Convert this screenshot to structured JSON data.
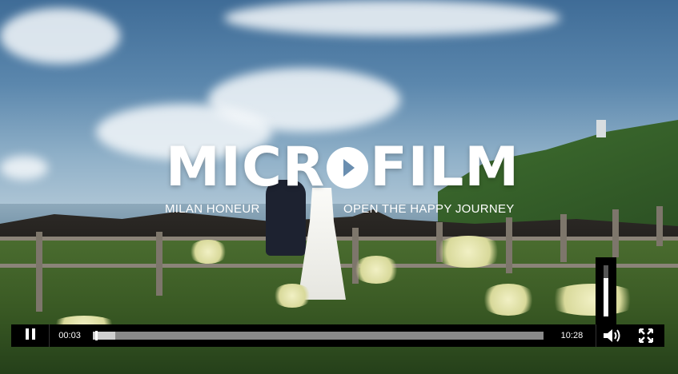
{
  "overlay": {
    "title_left": "MICRO F",
    "title_play": "O",
    "title_pre": "MICR",
    "title_post": " FILM",
    "subtitle_left": "MILAN HONEUR",
    "subtitle_right": "OPEN THE HAPPY JOURNEY"
  },
  "player": {
    "current_time": "00:03",
    "duration": "10:28",
    "progress_fraction": 0.005,
    "buffered_fraction": 0.05,
    "volume_fraction": 0.75,
    "icons": {
      "pause": "pause-icon",
      "volume": "volume-icon",
      "fullscreen": "fullscreen-icon"
    }
  },
  "colors": {
    "bar": "#000000",
    "progress_track": "#8a8a8a",
    "accent": "#ffffff"
  }
}
